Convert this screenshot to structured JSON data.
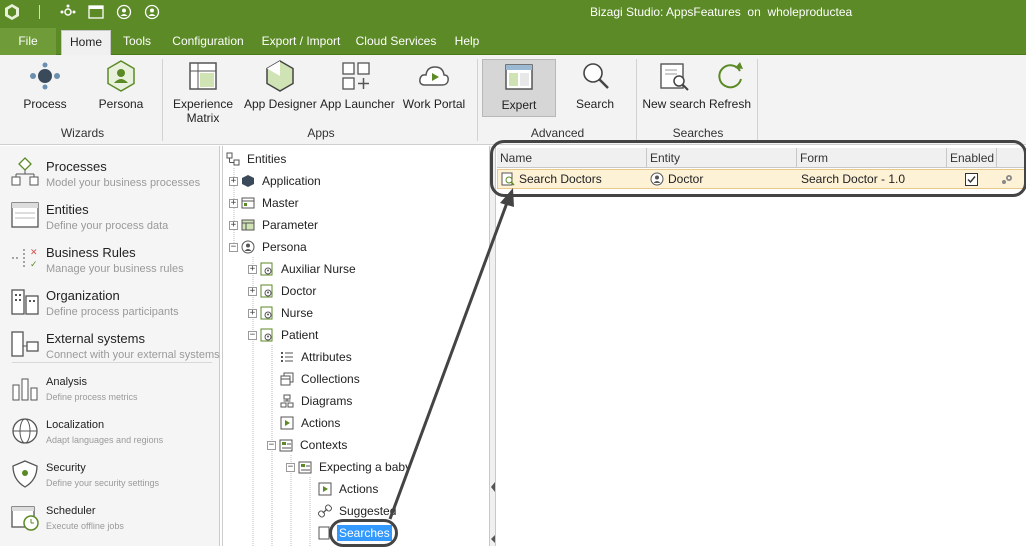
{
  "window": {
    "title": "Bizagi Studio: AppsFeatures  on  wholeproductea"
  },
  "menu": {
    "tabs": [
      "File",
      "Home",
      "Tools",
      "Configuration",
      "Export / Import",
      "Cloud Services",
      "Help"
    ],
    "active": "Home"
  },
  "ribbon": {
    "buttons": [
      "Process",
      "Persona",
      "Experience Matrix",
      "App Designer",
      "App Launcher",
      "Work Portal",
      "Expert",
      "Search",
      "New search",
      "Refresh"
    ],
    "experience_line1": "Experience",
    "experience_line2": "Matrix",
    "groups": [
      "Wizards",
      "Apps",
      "Advanced",
      "Searches"
    ]
  },
  "left_panel": {
    "items": [
      {
        "title": "Processes",
        "subtitle": "Model your business processes"
      },
      {
        "title": "Entities",
        "subtitle": "Define your process data"
      },
      {
        "title": "Business Rules",
        "subtitle": "Manage your business rules"
      },
      {
        "title": "Organization",
        "subtitle": "Define process participants"
      },
      {
        "title": "External systems",
        "subtitle": "Connect with your external systems"
      },
      {
        "title": "Analysis",
        "subtitle": "Define process metrics"
      },
      {
        "title": "Localization",
        "subtitle": "Adapt languages and regions"
      },
      {
        "title": "Security",
        "subtitle": "Define your security settings"
      },
      {
        "title": "Scheduler",
        "subtitle": "Execute offline jobs"
      }
    ]
  },
  "tree": {
    "root": "Entities",
    "nodes": [
      "Application",
      "Master",
      "Parameter",
      "Persona",
      "Auxiliar Nurse",
      "Doctor",
      "Nurse",
      "Patient",
      "Attributes",
      "Collections",
      "Diagrams",
      "Actions",
      "Contexts",
      "Expecting a baby",
      "Actions",
      "Suggested",
      "Searches"
    ],
    "selected": "Searches"
  },
  "grid": {
    "columns": [
      "Name",
      "Entity",
      "Form",
      "Enabled"
    ],
    "rows": [
      {
        "name": "Search Doctors",
        "entity": "Doctor",
        "form": "Search Doctor - 1.0",
        "enabled": true
      }
    ]
  },
  "colors": {
    "brand": "#5b8a26",
    "selection": "#3399ff",
    "row_highlight": "#fdf1d6"
  }
}
